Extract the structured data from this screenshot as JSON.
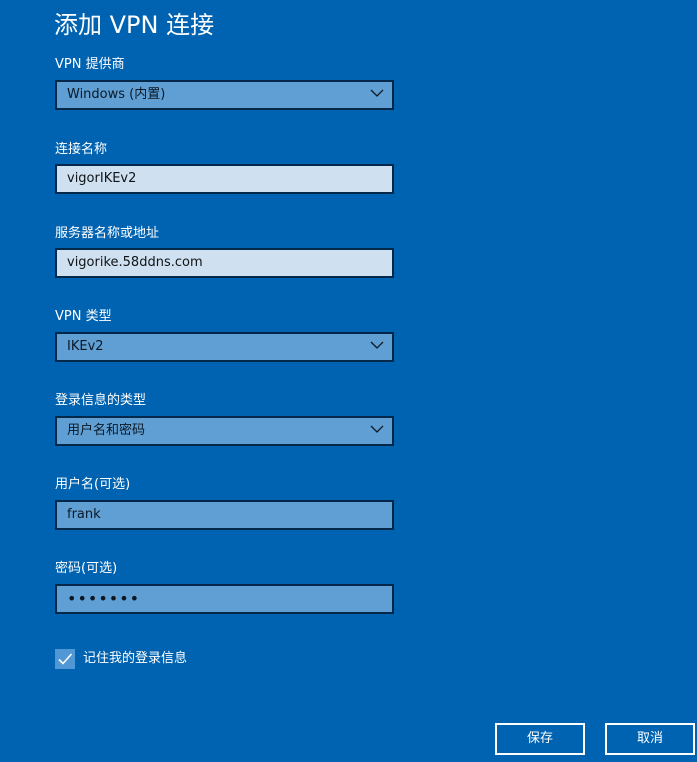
{
  "dialog": {
    "title": "添加 VPN 连接"
  },
  "fields": {
    "provider": {
      "label": "VPN 提供商",
      "value": "Windows (内置)"
    },
    "connection_name": {
      "label": "连接名称",
      "value": "vigorIKEv2"
    },
    "server": {
      "label": "服务器名称或地址",
      "value": "vigorike.58ddns.com"
    },
    "vpn_type": {
      "label": "VPN 类型",
      "value": "IKEv2"
    },
    "signin_type": {
      "label": "登录信息的类型",
      "value": "用户名和密码"
    },
    "username": {
      "label": "用户名(可选)",
      "value": "frank"
    },
    "password": {
      "label": "密码(可选)",
      "value": "•••••••"
    }
  },
  "remember": {
    "label": "记住我的登录信息",
    "checked": true
  },
  "buttons": {
    "save": "保存",
    "cancel": "取消"
  },
  "icons": {
    "dropdown": "chevron-down-icon",
    "check": "checkmark-icon"
  },
  "colors": {
    "background": "#0063b1",
    "field_selected": "#5f9fd4",
    "field_light": "#cfe1f0",
    "field_border": "#04284a",
    "text": "#ffffff"
  }
}
